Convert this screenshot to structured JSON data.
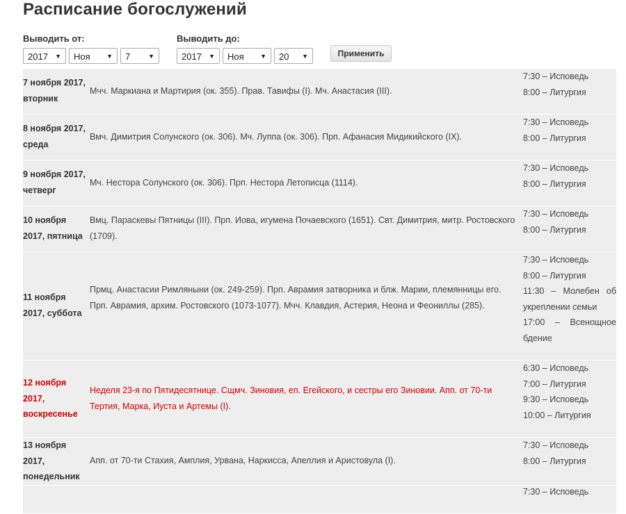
{
  "page": {
    "title": "Расписание богослужений"
  },
  "filters": {
    "from_label": "Выводить от:",
    "to_label": "Выводить до:",
    "from_year": "2017",
    "from_month": "Ноя",
    "from_day": "7",
    "to_year": "2017",
    "to_month": "Ноя",
    "to_day": "20",
    "apply_label": "Применить"
  },
  "schedule": [
    {
      "date": "7 ноября 2017, вторник",
      "desc": "Мчч. Маркиана и Мартирия (ок. 355). Прав. Тавифы (I). Мч. Анастасия (III).",
      "services": [
        "7:30 – Исповедь",
        "8:00 – Литургия"
      ],
      "sunday": false
    },
    {
      "date": "8 ноября 2017, среда",
      "desc": "Вмч. Димитрия Солунского (ок. 306). Мч. Луппа (ок. 306). Прп. Афанасия Мидикийского (IX).",
      "services": [
        "7:30 – Исповедь",
        "8:00 – Литургия"
      ],
      "sunday": false
    },
    {
      "date": "9 ноября 2017, четверг",
      "desc": "Мч. Нестора Солунского (ок. 306). Прп. Нестора Летописца (1114).",
      "services": [
        "7:30 – Исповедь",
        "8:00 – Литургия"
      ],
      "sunday": false
    },
    {
      "date": "10 ноября 2017, пятница",
      "desc": "Вмц. Параскевы Пятницы (III). Прп. Иова, игумена Почаевского (1651). Свт. Димитрия, митр. Ростовского (1709).",
      "services": [
        "7:30 – Исповедь",
        "8:00 – Литургия"
      ],
      "sunday": false
    },
    {
      "date": "11 ноября 2017, суббота",
      "desc": "Прмц. Анастасии Римляныни (ок. 249-259). Прп. Аврамия затворника и блж. Марии, племянницы его. Прп. Аврамия, архим. Ростовского (1073-1077). Мчч. Клавдия, Астерия, Неона и Феониллы (285).",
      "services": [
        "7:30 – Исповедь",
        "8:00 – Литургия",
        "11:30 – Молебен об укреплении семьи",
        "17:00 – Всенощное бдение"
      ],
      "sunday": false
    },
    {
      "date": "12 ноября 2017, воскресенье",
      "desc": "Неделя 23-я по Пятидесятнице. Сщмч. Зиновия, еп. Егейского, и сестры его Зиновии. Апп. от 70-ти Тертия, Марка, Иуста и Артемы (I).",
      "services": [
        "6:30 – Исповедь",
        "7:00 – Литургия",
        "9:30 – Исповедь",
        "10:00 – Литургия"
      ],
      "sunday": true
    },
    {
      "date": "13 ноября 2017, понедельник",
      "desc": "Апп. от 70-ти Стахия, Амплия, Урвана, Наркисса, Апеллия и Аристовула (I).",
      "services": [
        "7:30 – Исповедь",
        "8:00 – Литургия"
      ],
      "sunday": false
    },
    {
      "date": "",
      "desc": "",
      "services": [
        "7:30 – Исповедь"
      ],
      "sunday": false
    }
  ],
  "colors": {
    "row_background": "#eeeeee",
    "sunday_text": "#d40000",
    "text": "#333333"
  }
}
